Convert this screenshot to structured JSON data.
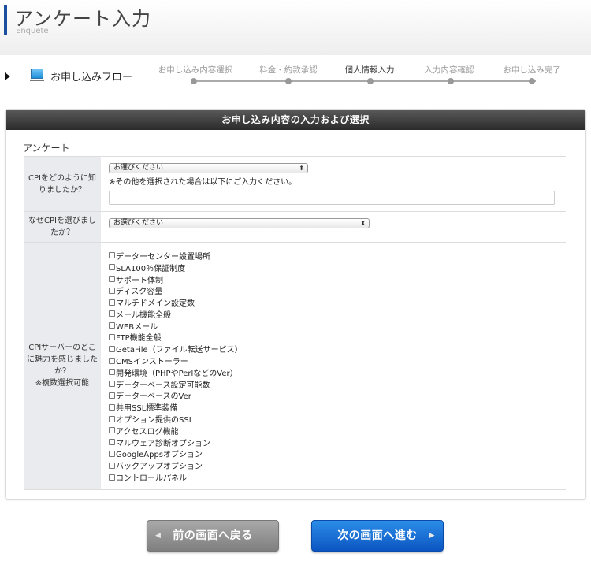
{
  "header": {
    "title": "アンケート入力",
    "subtitle": "Enquete"
  },
  "flow": {
    "label": "お申し込みフロー",
    "steps": [
      {
        "label": "お申し込み内容選択"
      },
      {
        "label": "料金・約款承認"
      },
      {
        "label": "個人情報入力"
      },
      {
        "label": "入力内容確認"
      },
      {
        "label": "お申し込み完了"
      }
    ],
    "current_step": "個人情報入力"
  },
  "panel": {
    "title": "お申し込み内容の入力および選択",
    "section_title": "アンケート"
  },
  "form": {
    "q1": {
      "label": "CPIをどのように知りましたか？",
      "select_value": "お選びください",
      "note": "※その他を選択された場合は以下にご入力ください。",
      "text_value": ""
    },
    "q2": {
      "label": "なぜCPIを選びましたか？",
      "select_value": "お選びください"
    },
    "q3": {
      "label_line1": "CPIサーバーのどこに魅力を感じましたか？",
      "label_line2": "※複数選択可能",
      "options": [
        "データーセンター設置場所",
        "SLA100％保証制度",
        "サポート体制",
        "ディスク容量",
        "マルチドメイン設定数",
        "メール機能全般",
        "WEBメール",
        "FTP機能全般",
        "GetaFile（ファイル転送サービス）",
        "CMSインストーラー",
        "開発環境（PHPやPerlなどのVer）",
        "データーベース設定可能数",
        "データーベースのVer",
        "共用SSL標準装備",
        "オプション提供のSSL",
        "アクセスログ機能",
        "マルウェア診断オプション",
        "GoogleAppsオプション",
        "バックアップオプション",
        "コントロールパネル"
      ]
    }
  },
  "buttons": {
    "back_label": "前の画面へ戻る",
    "next_label": "次の画面へ進む"
  },
  "colors": {
    "accent": "#1a4fa0",
    "next_button": "#0b55c2",
    "back_button": "#8c8c8c",
    "panel_header": "#333333"
  }
}
